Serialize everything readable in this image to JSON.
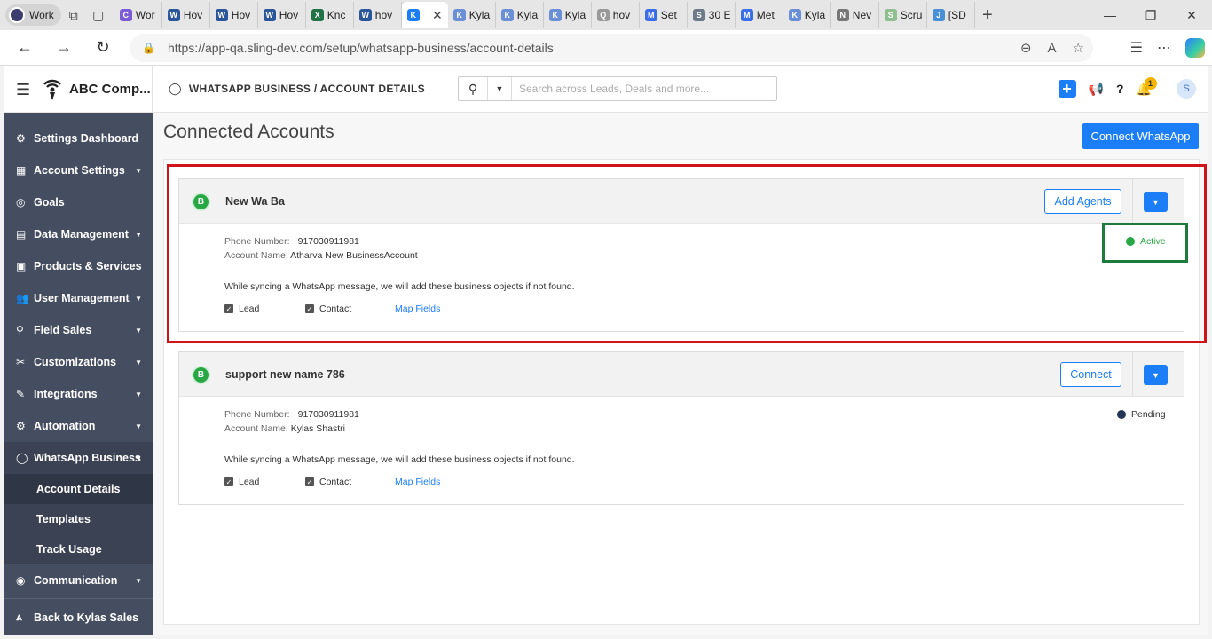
{
  "browser": {
    "profile_label": "Work",
    "tabs": [
      {
        "label": "Wor",
        "color": "#7b5cd6",
        "glyph": "C"
      },
      {
        "label": "Hov",
        "color": "#2b579a",
        "glyph": "W"
      },
      {
        "label": "Hov",
        "color": "#2b579a",
        "glyph": "W"
      },
      {
        "label": "Hov",
        "color": "#2b579a",
        "glyph": "W"
      },
      {
        "label": "Knc",
        "color": "#217346",
        "glyph": "X"
      },
      {
        "label": "hov",
        "color": "#2b579a",
        "glyph": "W"
      },
      {
        "label": "",
        "color": "#1c7ef7",
        "glyph": "K",
        "active": true
      },
      {
        "label": "Kyla",
        "color": "#6b8fd6",
        "glyph": "K"
      },
      {
        "label": "Kyla",
        "color": "#6b8fd6",
        "glyph": "K"
      },
      {
        "label": "Kyla",
        "color": "#6b8fd6",
        "glyph": "K"
      },
      {
        "label": "hov",
        "color": "#999999",
        "glyph": "Q"
      },
      {
        "label": "Set",
        "color": "#3b6ee8",
        "glyph": "M"
      },
      {
        "label": "30 E",
        "color": "#6c7a89",
        "glyph": "S"
      },
      {
        "label": "Met",
        "color": "#3b6ee8",
        "glyph": "M"
      },
      {
        "label": "Kyla",
        "color": "#6b8fd6",
        "glyph": "K"
      },
      {
        "label": "Nev",
        "color": "#777777",
        "glyph": "N"
      },
      {
        "label": "Scru",
        "color": "#8fbf8f",
        "glyph": "S"
      },
      {
        "label": "[SD",
        "color": "#4a90d9",
        "glyph": "J"
      }
    ],
    "url": "https://app-qa.sling-dev.com/setup/whatsapp-business/account-details"
  },
  "header": {
    "brand": "ABC Comp...",
    "breadcrumb": "WHATSAPP BUSINESS / ACCOUNT DETAILS",
    "search_placeholder": "Search across Leads, Deals and more...",
    "notification_count": "1",
    "avatar_initial": "S"
  },
  "sidebar": {
    "items": [
      {
        "label": "Settings Dashboard",
        "icon": "gear-icon",
        "glyph": "⚙",
        "caret": false
      },
      {
        "label": "Account Settings",
        "icon": "building-icon",
        "glyph": "▦",
        "caret": true
      },
      {
        "label": "Goals",
        "icon": "target-icon",
        "glyph": "◎",
        "caret": false
      },
      {
        "label": "Data Management",
        "icon": "table-icon",
        "glyph": "▤",
        "caret": true
      },
      {
        "label": "Products & Services",
        "icon": "briefcase-icon",
        "glyph": "▣",
        "caret": false
      },
      {
        "label": "User Management",
        "icon": "users-icon",
        "glyph": "👥",
        "caret": true
      },
      {
        "label": "Field Sales",
        "icon": "location-icon",
        "glyph": "⚲",
        "caret": true
      },
      {
        "label": "Customizations",
        "icon": "tools-icon",
        "glyph": "✂",
        "caret": true
      },
      {
        "label": "Integrations",
        "icon": "plug-icon",
        "glyph": "✎",
        "caret": true
      },
      {
        "label": "Automation",
        "icon": "cogs-icon",
        "glyph": "⚙",
        "caret": true
      },
      {
        "label": "WhatsApp Business",
        "icon": "whatsapp-icon",
        "glyph": "◯",
        "caret": true,
        "open": true
      }
    ],
    "sub_items": [
      {
        "label": "Account Details",
        "active": true
      },
      {
        "label": "Templates",
        "active": false
      },
      {
        "label": "Track Usage",
        "active": false
      }
    ],
    "after_items": [
      {
        "label": "Communication",
        "icon": "chat-icon",
        "glyph": "◉",
        "caret": true
      }
    ],
    "back_label": "Back to Kylas Sales"
  },
  "main": {
    "title": "Connected Accounts",
    "connect_button": "Connect WhatsApp",
    "phone_label": "Phone Number:",
    "account_label": "Account Name:",
    "sync_note": "While syncing a WhatsApp message, we will add these business objects if not found.",
    "lead_label": "Lead",
    "contact_label": "Contact",
    "map_fields": "Map Fields",
    "accounts": [
      {
        "name": "New Wa Ba",
        "action": "Add Agents",
        "phone": "+917030911981",
        "account_name": "Atharva New BusinessAccount",
        "status": "Active",
        "status_color": "#28a745",
        "status_text_color": "#28a745"
      },
      {
        "name": "support new name 786",
        "action": "Connect",
        "phone": "+917030911981",
        "account_name": "Kylas Shastri",
        "status": "Pending",
        "status_color": "#233554",
        "status_text_color": "#333333"
      }
    ]
  }
}
